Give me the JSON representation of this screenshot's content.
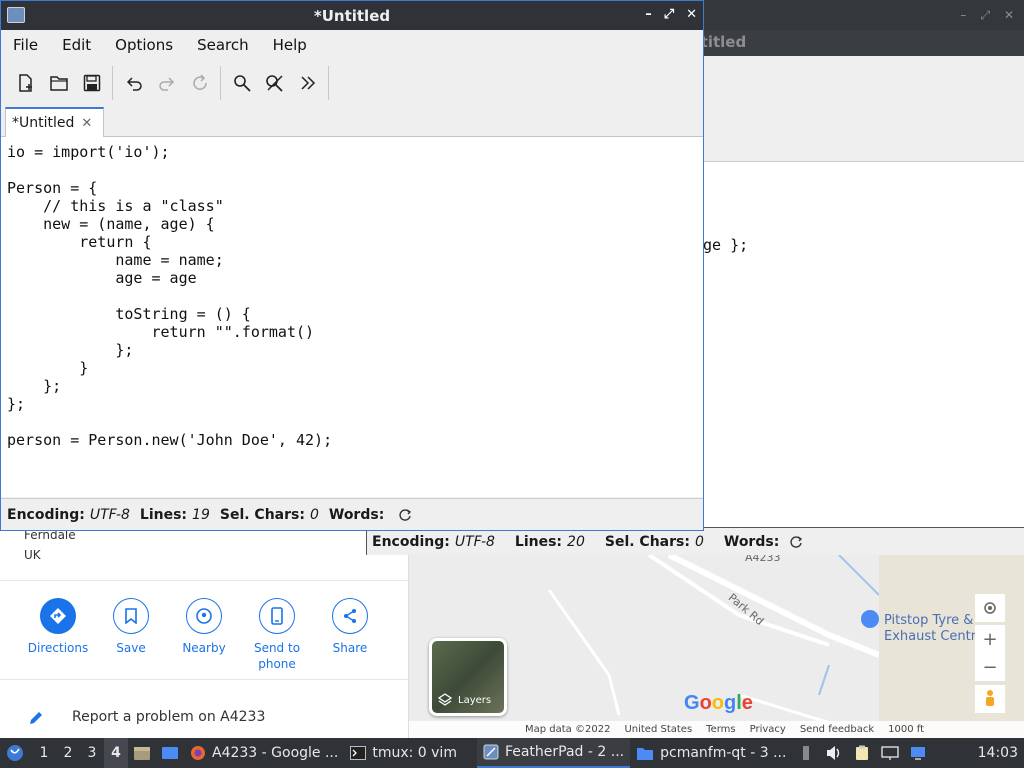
{
  "maps": {
    "address_line1": "Ferndale",
    "address_line2": "UK",
    "actions": [
      {
        "label": "Directions",
        "icon": "directions-icon"
      },
      {
        "label": "Save",
        "icon": "bookmark-icon"
      },
      {
        "label": "Nearby",
        "icon": "nearby-icon"
      },
      {
        "label": "Send to phone",
        "icon": "phone-icon"
      },
      {
        "label": "Share",
        "icon": "share-icon"
      }
    ],
    "report_text": "Report a problem on A4233",
    "map": {
      "road_label_top": "A4233",
      "road_label_park": "Park Rd",
      "place_line1": "Pitstop Tyre &",
      "place_line2": "Exhaust Centre",
      "layers_label": "Layers",
      "logo_text": "Google",
      "footer": [
        "Map data ©2022",
        "United States",
        "Terms",
        "Privacy",
        "Send feedback",
        "1000 ft"
      ]
    },
    "accent_color": "#1a73e8"
  },
  "featherpad2": {
    "title_partial": "ntitled",
    "code_partial": "ge };",
    "status": {
      "encoding_label": "Encoding:",
      "encoding_value": "UTF-8",
      "lines_label": "Lines:",
      "lines_value": "20",
      "sel_label": "Sel. Chars:",
      "sel_value": "0",
      "words_label": "Words:"
    }
  },
  "featherpad": {
    "title": "*Untitled",
    "window_controls": [
      "–",
      "⤢",
      "✕"
    ],
    "menu": [
      "File",
      "Edit",
      "Options",
      "Search",
      "Help"
    ],
    "toolbar": [
      "new-file-icon",
      "open-icon",
      "save-icon",
      "undo-icon",
      "redo-icon",
      "reload-icon",
      "find-icon",
      "replace-icon",
      "more-icon"
    ],
    "tab_label": "*Untitled",
    "code": "io = import('io');\n\nPerson = {\n    // this is a \"class\"\n    new = (name, age) {\n        return {\n            name = name;\n            age = age\n\n            toString = () {\n                return \"\".format()\n            };\n        }\n    };\n};\n\nperson = Person.new('John Doe', 42);",
    "status": {
      "encoding_label": "Encoding:",
      "encoding_value": "UTF-8",
      "lines_label": "Lines:",
      "lines_value": "19",
      "sel_label": "Sel. Chars:",
      "sel_value": "0",
      "words_label": "Words:"
    },
    "accent_color": "#3c7ad6"
  },
  "taskbar": {
    "workspaces": [
      "1",
      "2",
      "3",
      "4"
    ],
    "current_workspace": "4",
    "tasks": [
      {
        "label": "A4233 - Google ...",
        "icon": "firefox-icon"
      },
      {
        "label": "tmux: 0 vim",
        "icon": "terminal-icon"
      },
      {
        "label": "FeatherPad - 2 ...",
        "icon": "featherpad-icon"
      },
      {
        "label": "pcmanfm-qt - 3 ...",
        "icon": "folder-icon"
      }
    ],
    "clock": "14:03"
  }
}
